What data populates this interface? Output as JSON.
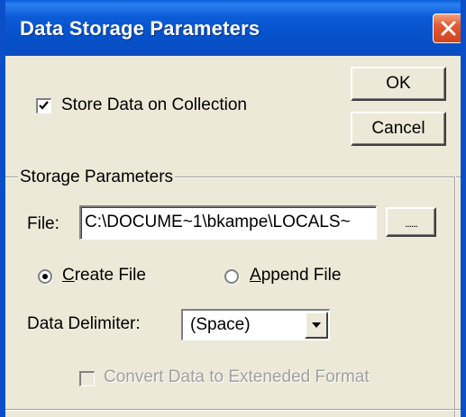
{
  "window": {
    "title": "Data Storage Parameters"
  },
  "buttons": {
    "ok_label": "OK",
    "cancel_label": "Cancel",
    "browse_label": "......"
  },
  "store_data": {
    "label": "Store Data on Collection",
    "checked": true
  },
  "storage_group": {
    "label": "Storage Parameters",
    "file_label": "File:",
    "file_value": "C:\\DOCUME~1\\bkampe\\LOCALS~",
    "radio_create": {
      "accel": "C",
      "rest": "reate File",
      "checked": true
    },
    "radio_append": {
      "accel": "A",
      "rest": "ppend File",
      "checked": false
    },
    "delimiter_label": "Data Delimiter:",
    "delimiter_value": "(Space)",
    "convert_label": "Convert Data to Exteneded Format",
    "convert_checked": false,
    "convert_enabled": false
  },
  "icons": {
    "close": "close-icon",
    "check": "check-icon",
    "dropdown": "chevron-down-icon"
  },
  "colors": {
    "titlebar": "#0a5fd8",
    "dialog_bg": "#ece9d8",
    "close_button": "#e25a30",
    "disabled_text": "#a0a0a0"
  }
}
